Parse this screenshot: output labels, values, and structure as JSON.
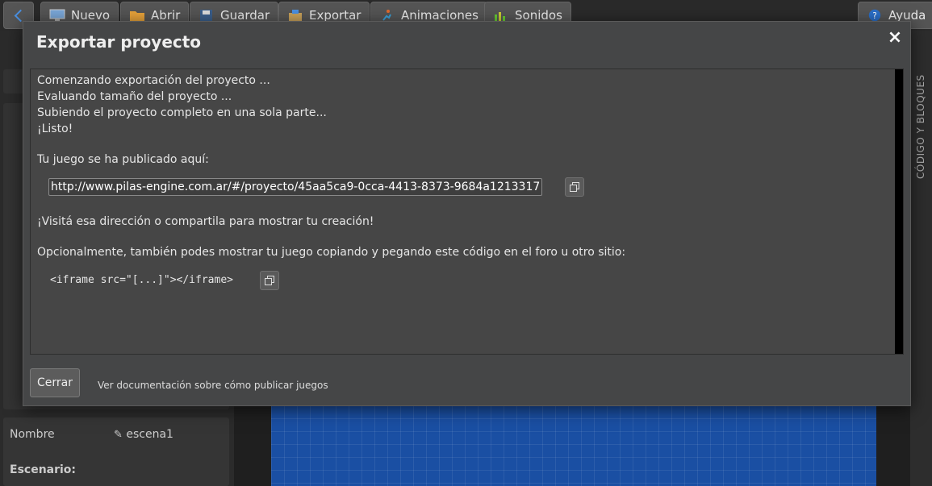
{
  "toolbar": {
    "buttons": [
      {
        "label": "Nuevo",
        "icon": "monitor-icon"
      },
      {
        "label": "Abrir",
        "icon": "folder-icon"
      },
      {
        "label": "Guardar",
        "icon": "floppy-icon"
      },
      {
        "label": "Exportar",
        "icon": "export-box-icon"
      },
      {
        "label": "Animaciones",
        "icon": "runner-icon"
      },
      {
        "label": "Sonidos",
        "icon": "equalizer-icon"
      }
    ],
    "help_label": "Ayuda"
  },
  "side_panel": {
    "vertical_tab": "CÓDIGO Y BLOQUES"
  },
  "properties": {
    "name_label": "Nombre",
    "name_value": "escena1",
    "scene_label": "Escenario:"
  },
  "modal": {
    "title": "Exportar proyecto",
    "close_glyph": "×",
    "log_lines": [
      "Comenzando exportación del proyecto ...",
      "Evaluando tamaño del proyecto ...",
      "Subiendo el proyecto completo en una sola parte...",
      "¡Listo!"
    ],
    "published_label": "Tu juego se ha publicado aquí:",
    "url": "http://www.pilas-engine.com.ar/#/proyecto/45aa5ca9-0cca-4413-8373-9684a1213317",
    "visit_text": "¡Visitá esa dirección o compartila para mostrar tu creación!",
    "embed_text": "Opcionalmente, también podes mostrar tu juego copiando y pegando este código en el foro u otro sitio:",
    "embed_code": "<iframe src=\"[...]\"></iframe>",
    "close_button": "Cerrar",
    "docs_link": "Ver documentación sobre cómo publicar juegos"
  },
  "colors": {
    "accent": "#4a90e2",
    "stage_blue": "#1a4fa3",
    "modal_bg": "#454647"
  }
}
